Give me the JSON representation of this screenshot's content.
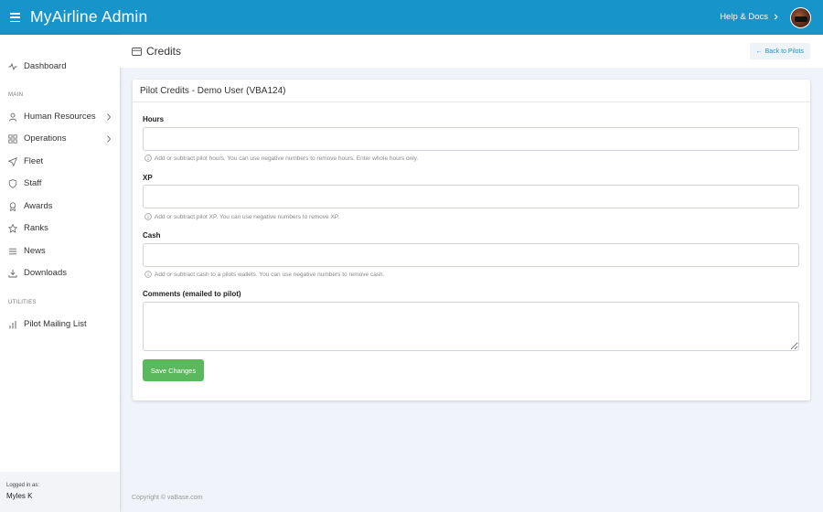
{
  "header": {
    "brand": "MyAirline Admin",
    "help_label": "Help & Docs"
  },
  "sidebar": {
    "dashboard": "Dashboard",
    "section_main": "MAIN",
    "items": [
      {
        "label": "Human Resources",
        "icon": "user-icon",
        "has_children": true
      },
      {
        "label": "Operations",
        "icon": "grid-icon",
        "has_children": true
      },
      {
        "label": "Fleet",
        "icon": "send-icon",
        "has_children": false
      },
      {
        "label": "Staff",
        "icon": "shield-icon",
        "has_children": false
      },
      {
        "label": "Awards",
        "icon": "award-icon",
        "has_children": false
      },
      {
        "label": "Ranks",
        "icon": "star-icon",
        "has_children": false
      },
      {
        "label": "News",
        "icon": "list-icon",
        "has_children": false
      },
      {
        "label": "Downloads",
        "icon": "download-icon",
        "has_children": false
      }
    ],
    "section_utilities": "UTILITIES",
    "utilities": [
      {
        "label": "Pilot Mailing List",
        "icon": "bar-chart-icon"
      }
    ],
    "logged_in_label": "Logged in as:",
    "logged_in_user": "Myles K"
  },
  "page": {
    "title": "Credits",
    "back_label": "Back to Pilots"
  },
  "card": {
    "title": "Pilot Credits - Demo User (VBA124)",
    "hours_label": "Hours",
    "hours_value": "",
    "hours_help": "Add or subtract pilot hours. You can use negative numbers to remove hours. Enter whole hours only.",
    "xp_label": "XP",
    "xp_value": "",
    "xp_help": "Add or subtract pilot XP. You can use negative numbers to remove XP.",
    "cash_label": "Cash",
    "cash_value": "",
    "cash_help": "Add or subtract cash to a pilots wallets. You can use negative numbers to remove cash.",
    "comments_label": "Comments (emailed to pilot)",
    "comments_value": "",
    "save_label": "Save Changes"
  },
  "footer": {
    "copyright": "Copyright © vaBase.com"
  },
  "colors": {
    "topbar": "#1794c9",
    "save_button": "#5cb85c",
    "background": "#f1f3fa"
  }
}
